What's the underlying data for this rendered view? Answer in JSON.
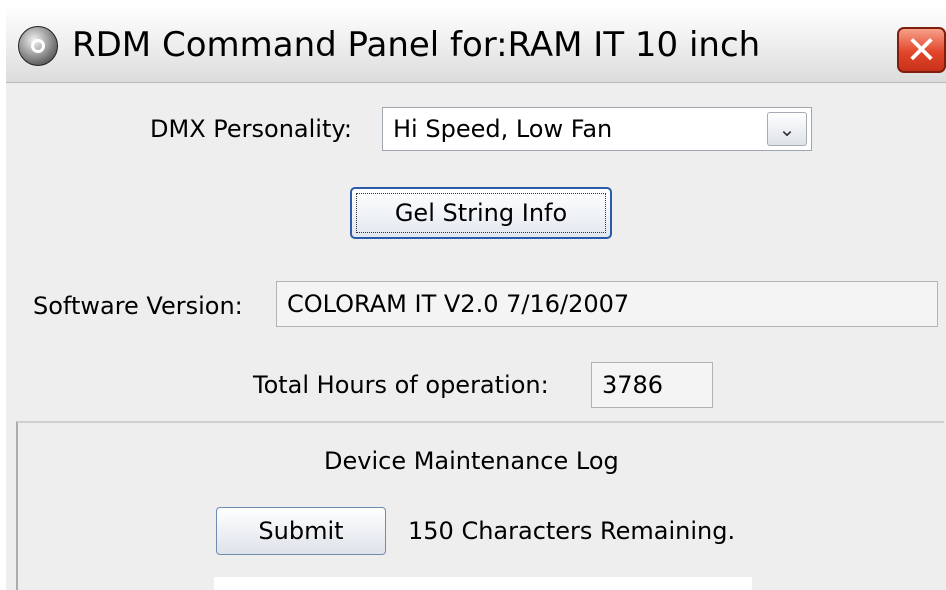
{
  "window": {
    "title": "RDM Command Panel for:RAM IT 10 inch",
    "close_glyph": "✕",
    "icon": "app-globe-icon"
  },
  "dmx_personality": {
    "label": "DMX Personality:",
    "selected": "Hi Speed, Low Fan",
    "arrow_glyph": "⌄"
  },
  "gel_string_button": {
    "label": "Gel String Info"
  },
  "software_version": {
    "label": "Software Version:",
    "value": "COLORAM IT V2.0 7/16/2007"
  },
  "total_hours": {
    "label": "Total Hours of operation:",
    "value": "3786"
  },
  "maintenance_log": {
    "title": "Device Maintenance Log",
    "submit_label": "Submit",
    "remaining_text": "150 Characters Remaining.",
    "text_value": ""
  },
  "colors": {
    "panel_background": "#eeeeee",
    "close_button": "#e2462a",
    "focus_border": "#2a5aa8"
  }
}
